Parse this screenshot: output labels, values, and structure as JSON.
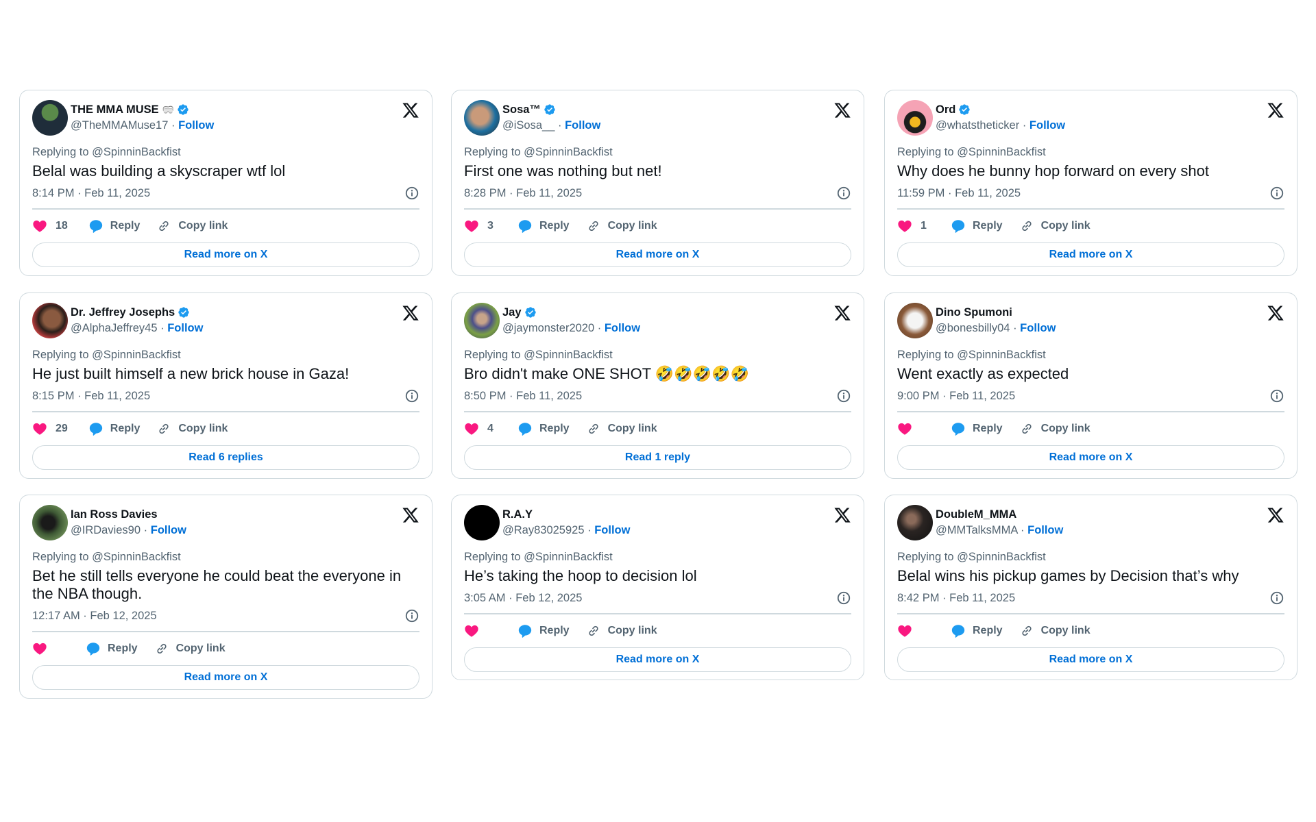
{
  "colors": {
    "text": "#0f1419",
    "secondary": "#536471",
    "link": "#006fd6",
    "like": "#f91880",
    "reply": "#1d9bf0",
    "verified": "#1d9bf0",
    "border": "#cfd9de"
  },
  "labels": {
    "follow": "Follow",
    "reply": "Reply",
    "copy_link": "Copy link",
    "separator": "·"
  },
  "tweets": [
    {
      "name": "THE MMA MUSE",
      "name_emoji": "🥽",
      "verified": true,
      "handle": "@TheMMAMuse17",
      "replying_to": "Replying to @SpinninBackfist",
      "text": "Belal was building a skyscraper wtf lol",
      "timestamp": "8:14 PM · Feb 11, 2025",
      "likes": "18",
      "cta": "Read more on X",
      "avatar_icon": "avatar-frog-ufc"
    },
    {
      "name": "Sosa™",
      "verified": true,
      "handle": "@iSosa__",
      "replying_to": "Replying to @SpinninBackfist",
      "text": "First one was nothing but net!",
      "timestamp": "8:28 PM · Feb 11, 2025",
      "likes": "3",
      "cta": "Read more on X",
      "avatar_icon": "avatar-photo"
    },
    {
      "name": "Ord",
      "verified": true,
      "handle": "@whatstheticker",
      "replying_to": "Replying to @SpinninBackfist",
      "text": "Why does he bunny hop forward on every shot",
      "timestamp": "11:59 PM · Feb 11, 2025",
      "likes": "1",
      "cta": "Read more on X",
      "avatar_icon": "avatar-cartoon-pink"
    },
    {
      "name": "Dr. Jeffrey Josephs",
      "verified": true,
      "handle": "@AlphaJeffrey45",
      "replying_to": "Replying to @SpinninBackfist",
      "text": "He just built himself a new brick house in Gaza!",
      "timestamp": "8:15 PM · Feb 11, 2025",
      "likes": "29",
      "cta": "Read 6 replies",
      "avatar_icon": "avatar-photo-flag"
    },
    {
      "name": "Jay",
      "verified": true,
      "handle": "@jaymonster2020",
      "replying_to": "Replying to @SpinninBackfist",
      "text": "Bro didn't make ONE SHOT 🤣🤣🤣🤣🤣",
      "timestamp": "8:50 PM · Feb 11, 2025",
      "likes": "4",
      "cta": "Read 1 reply",
      "avatar_icon": "avatar-photo-stadium"
    },
    {
      "name": "Dino Spumoni",
      "verified": false,
      "handle": "@bonesbilly04",
      "replying_to": "Replying to @SpinninBackfist",
      "text": "Went exactly as expected",
      "timestamp": "9:00 PM · Feb 11, 2025",
      "likes": "",
      "cta": "Read more on X",
      "avatar_icon": "avatar-yeti"
    },
    {
      "name": "Ian Ross Davies",
      "verified": false,
      "handle": "@IRDavies90",
      "replying_to": "Replying to @SpinninBackfist",
      "text": "Bet he still tells everyone he could beat the everyone in the NBA though.",
      "timestamp": "12:17 AM · Feb 12, 2025",
      "likes": "",
      "cta": "Read more on X",
      "avatar_icon": "avatar-photo-outdoor"
    },
    {
      "name": "R.A.Y",
      "verified": false,
      "handle": "@Ray83025925",
      "replying_to": "Replying to @SpinninBackfist",
      "text": "He’s taking the hoop to decision lol",
      "timestamp": "3:05 AM · Feb 12, 2025",
      "likes": "",
      "cta": "Read more on X",
      "avatar_icon": "avatar-black"
    },
    {
      "name": "DoubleM_MMA",
      "verified": false,
      "handle": "@MMTalksMMA",
      "replying_to": "Replying to @SpinninBackfist",
      "text": "Belal wins his pickup games by Decision that’s why",
      "timestamp": "8:42 PM · Feb 11, 2025",
      "likes": "",
      "cta": "Read more on X",
      "avatar_icon": "avatar-photo-dark"
    }
  ]
}
